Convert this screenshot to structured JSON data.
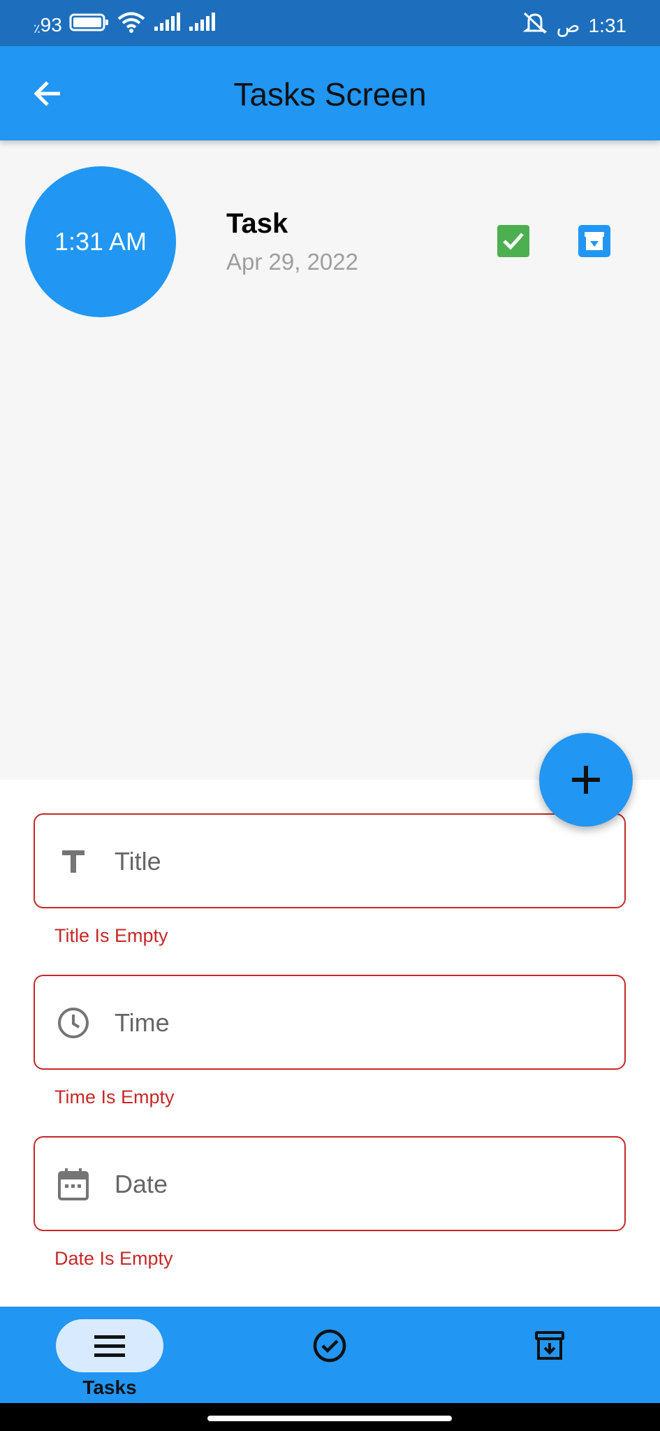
{
  "status_bar": {
    "battery": "93",
    "battery_unit": "٪",
    "time": "1:31",
    "ampm": "ص"
  },
  "app_bar": {
    "title": "Tasks Screen"
  },
  "task": {
    "time": "1:31 AM",
    "title": "Task",
    "date": "Apr 29, 2022",
    "done": true
  },
  "form": {
    "title": {
      "placeholder": "Title",
      "value": "",
      "error": "Title Is Empty"
    },
    "time": {
      "placeholder": "Time",
      "value": "",
      "error": "Time Is Empty"
    },
    "date": {
      "placeholder": "Date",
      "value": "",
      "error": "Date Is Empty"
    }
  },
  "bottom_nav": {
    "items": [
      {
        "label": "Tasks",
        "icon": "menu-icon",
        "active": true
      },
      {
        "label": "",
        "icon": "check-circle-icon",
        "active": false
      },
      {
        "label": "",
        "icon": "archive-icon",
        "active": false
      }
    ]
  },
  "colors": {
    "primary": "#2196f3",
    "status_bar": "#1d6fbd",
    "error": "#c62828",
    "done": "#4caf50",
    "active_pill": "#d8eafd"
  }
}
